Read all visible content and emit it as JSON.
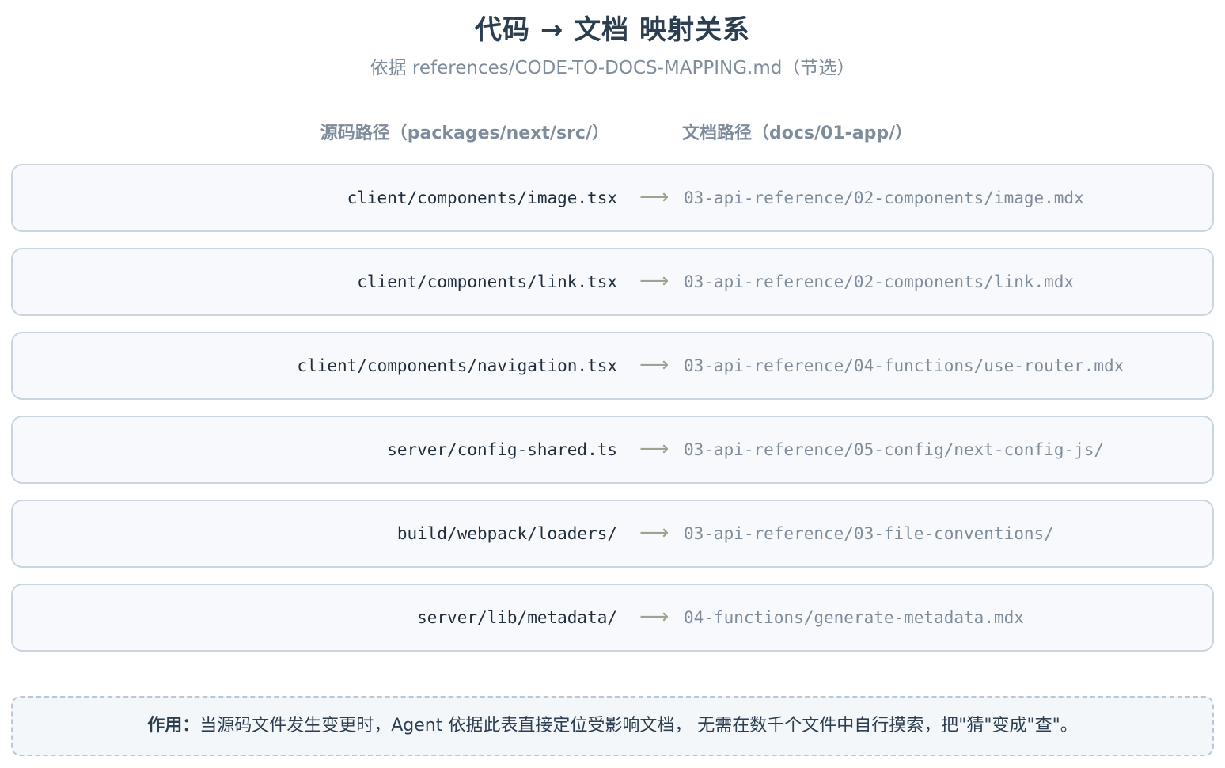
{
  "title": "代码 → 文档 映射关系",
  "subtitle": "依据 references/CODE-TO-DOCS-MAPPING.md（节选）",
  "columns": {
    "source": "源码路径（packages/next/src/）",
    "docs": "文档路径（docs/01-app/）"
  },
  "arrow_glyph": "⟶",
  "mappings": [
    {
      "source": "client/components/image.tsx",
      "doc": "03-api-reference/02-components/image.mdx"
    },
    {
      "source": "client/components/link.tsx",
      "doc": "03-api-reference/02-components/link.mdx"
    },
    {
      "source": "client/components/navigation.tsx",
      "doc": "03-api-reference/04-functions/use-router.mdx"
    },
    {
      "source": "server/config-shared.ts",
      "doc": "03-api-reference/05-config/next-config-js/"
    },
    {
      "source": "build/webpack/loaders/",
      "doc": "03-api-reference/03-file-conventions/"
    },
    {
      "source": "server/lib/metadata/",
      "doc": "04-functions/generate-metadata.mdx"
    }
  ],
  "note": {
    "label": "作用：",
    "text": "当源码文件发生变更时，Agent 依据此表直接定位受影响文档， 无需在数千个文件中自行摸索，把\"猜\"变成\"查\"。"
  }
}
